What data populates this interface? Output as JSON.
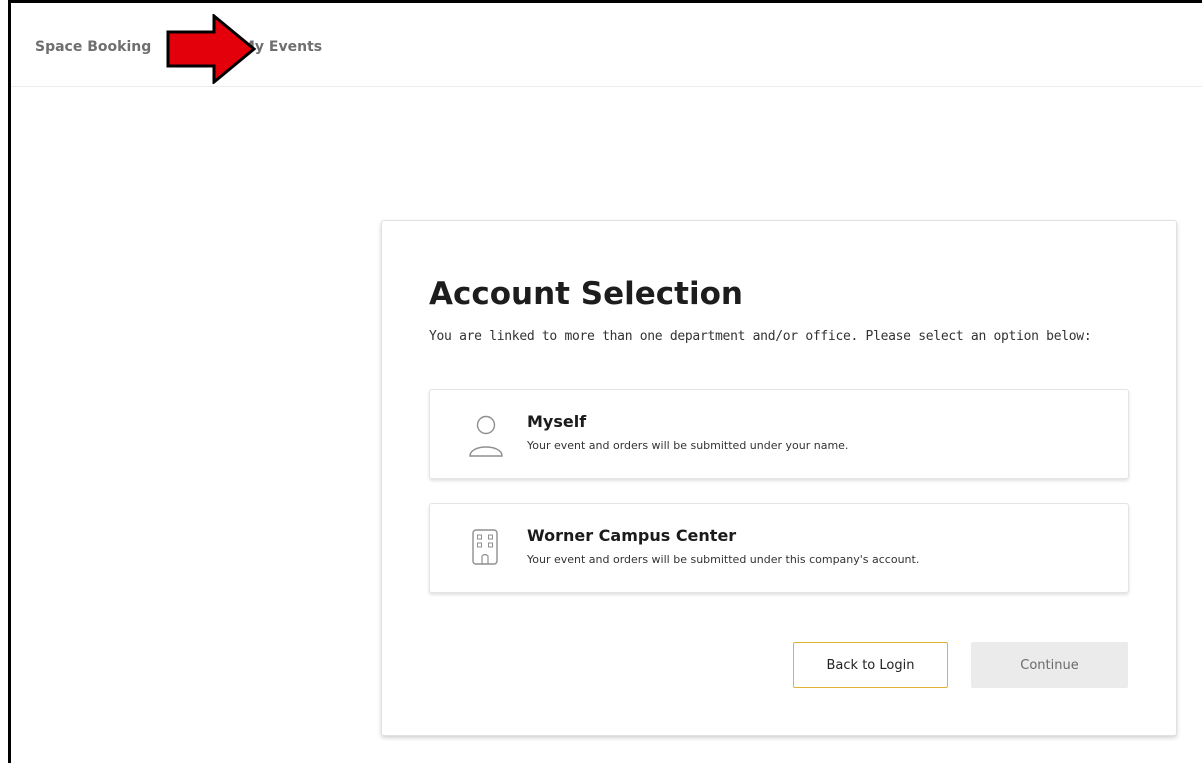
{
  "nav": {
    "space_booking": "Space Booking",
    "my_events": "My Events"
  },
  "card": {
    "title": "Account Selection",
    "subtitle": "You are linked to more than one department and/or office. Please select an option below:"
  },
  "options": [
    {
      "name": "Myself",
      "description": "Your event and orders will be submitted under your name.",
      "icon": "user-icon"
    },
    {
      "name": "Worner Campus Center",
      "description": "Your event and orders will be submitted under this company's account.",
      "icon": "building-icon"
    }
  ],
  "buttons": {
    "back": "Back to Login",
    "continue": "Continue"
  },
  "colors": {
    "annotation_arrow": "#e3000b",
    "back_button_border": "#e0b23a",
    "continue_bg": "#ebebeb"
  }
}
